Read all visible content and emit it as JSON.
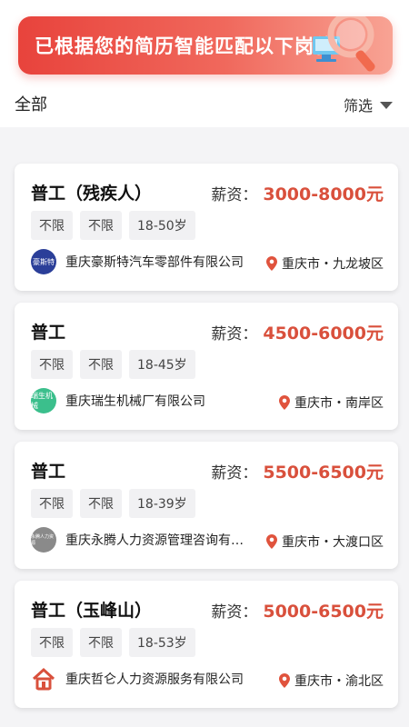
{
  "banner": {
    "text": "已根据您的简历智能匹配以下岗位"
  },
  "filter": {
    "all_label": "全部",
    "screen_label": "筛选"
  },
  "salary_label": "薪资：",
  "jobs": [
    {
      "title": "普工（残疾人）",
      "salary": "3000-8000元",
      "tags": [
        "不限",
        "不限",
        "18-50岁"
      ],
      "company": "重庆豪斯特汽车零部件有限公司",
      "logo_text": "豪斯特",
      "logo_color": "#2b3f99",
      "location": "重庆市・九龙坡区"
    },
    {
      "title": "普工",
      "salary": "4500-6000元",
      "tags": [
        "不限",
        "不限",
        "18-45岁"
      ],
      "company": "重庆瑞生机械厂有限公司",
      "logo_text": "瑞生机械",
      "logo_color": "#3bbf8c",
      "location": "重庆市・南岸区"
    },
    {
      "title": "普工",
      "salary": "5500-6500元",
      "tags": [
        "不限",
        "不限",
        "18-39岁"
      ],
      "company": "重庆永腾人力资源管理咨询有…",
      "logo_text": "永腾人力资源",
      "logo_color": "#8a8a8a",
      "location": "重庆市・大渡口区"
    },
    {
      "title": "普工（玉峰山）",
      "salary": "5000-6500元",
      "tags": [
        "不限",
        "不限",
        "18-53岁"
      ],
      "company": "重庆哲仑人力资源服务有限公司",
      "logo_text": "",
      "logo_color": "#d9503c",
      "location": "重庆市・渝北区"
    }
  ]
}
